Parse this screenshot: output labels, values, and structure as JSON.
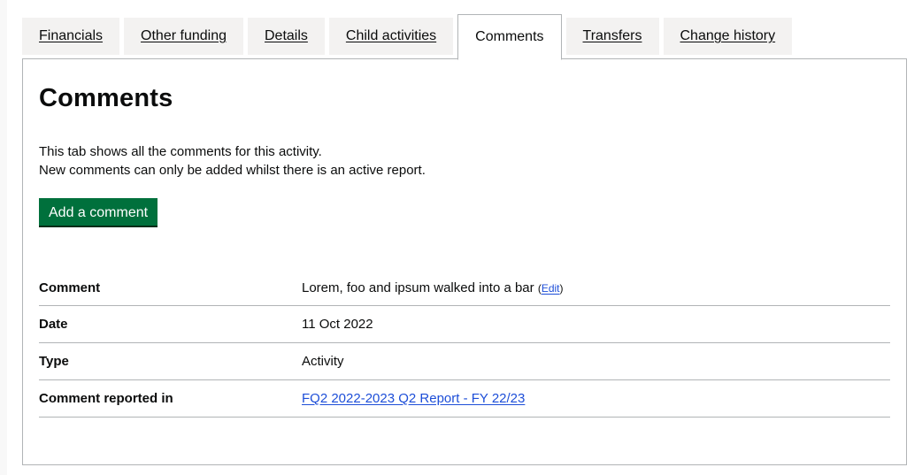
{
  "tabs": [
    {
      "label": "Financials",
      "selected": false
    },
    {
      "label": "Other funding",
      "selected": false
    },
    {
      "label": "Details",
      "selected": false
    },
    {
      "label": "Child activities",
      "selected": false
    },
    {
      "label": "Comments",
      "selected": true
    },
    {
      "label": "Transfers",
      "selected": false
    },
    {
      "label": "Change history",
      "selected": false
    }
  ],
  "panel": {
    "heading": "Comments",
    "intro_line_1": "This tab shows all the comments for this activity.",
    "intro_line_2": "New comments can only be added whilst there is an active report.",
    "add_button": "Add a comment"
  },
  "summary": {
    "comment": {
      "key": "Comment",
      "value": "Lorem, foo and ipsum walked into a bar",
      "edit_open": "(",
      "edit_label": "Edit",
      "edit_close": ")"
    },
    "date": {
      "key": "Date",
      "value": "11 Oct 2022"
    },
    "type": {
      "key": "Type",
      "value": "Activity"
    },
    "reported_in": {
      "key": "Comment reported in",
      "value": "FQ2 2022-2023 Q2 Report - FY 22/23"
    }
  },
  "colors": {
    "button": "#00703c",
    "link": "#1d4ed8",
    "border": "#b1b4b6",
    "tab_bg": "#f3f2f1"
  }
}
